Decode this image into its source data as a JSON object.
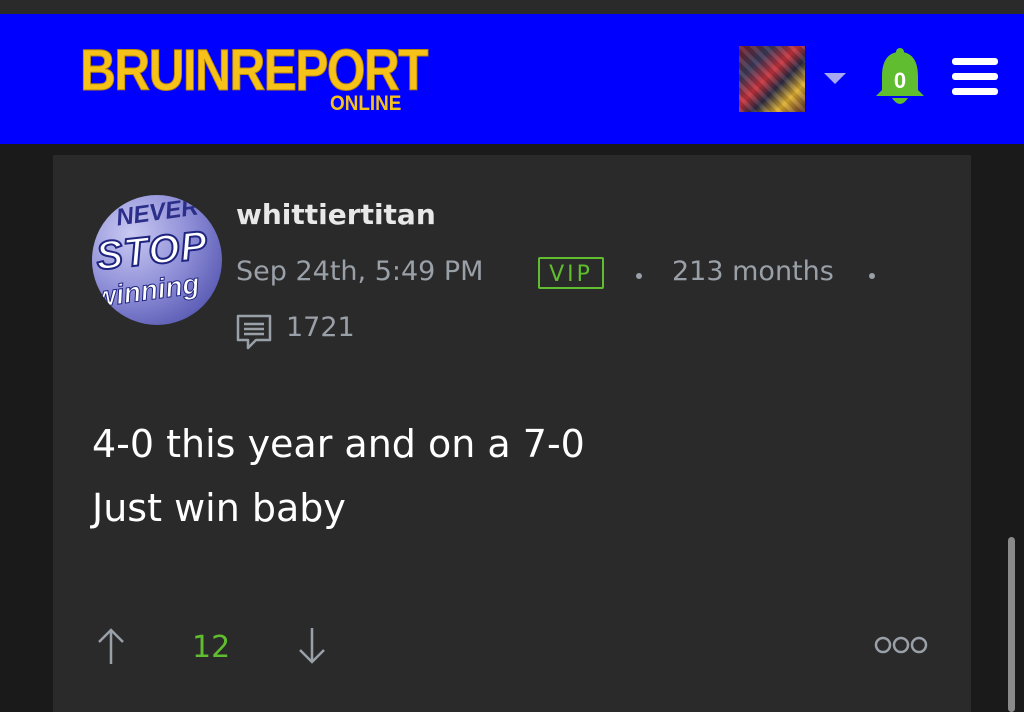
{
  "header": {
    "logo_main": "BRUINREPORT",
    "logo_sub": "ONLINE",
    "notification_count": "0",
    "colors": {
      "bar": "#0000ff",
      "logo": "#f6c21a",
      "bell": "#5fbd2f"
    }
  },
  "post": {
    "author": "whittiertitan",
    "avatar_text": [
      "NEVER",
      "STOP",
      "winning"
    ],
    "timestamp": "Sep 24th, 5:49 PM",
    "badge": "VIP",
    "tenure": "213 months",
    "post_count": "1721",
    "body_lines": [
      "4-0 this year and on a 7-0",
      "Just win baby"
    ],
    "vote_score": "12",
    "colors": {
      "accent": "#5fbd2f",
      "muted": "#9aa0a8"
    }
  },
  "icons": {
    "menu": "hamburger-icon",
    "bell": "bell-icon",
    "caret": "chevron-down-icon",
    "comment": "comment-icon",
    "up": "arrow-up-icon",
    "down": "arrow-down-icon",
    "more": "more-icon"
  }
}
